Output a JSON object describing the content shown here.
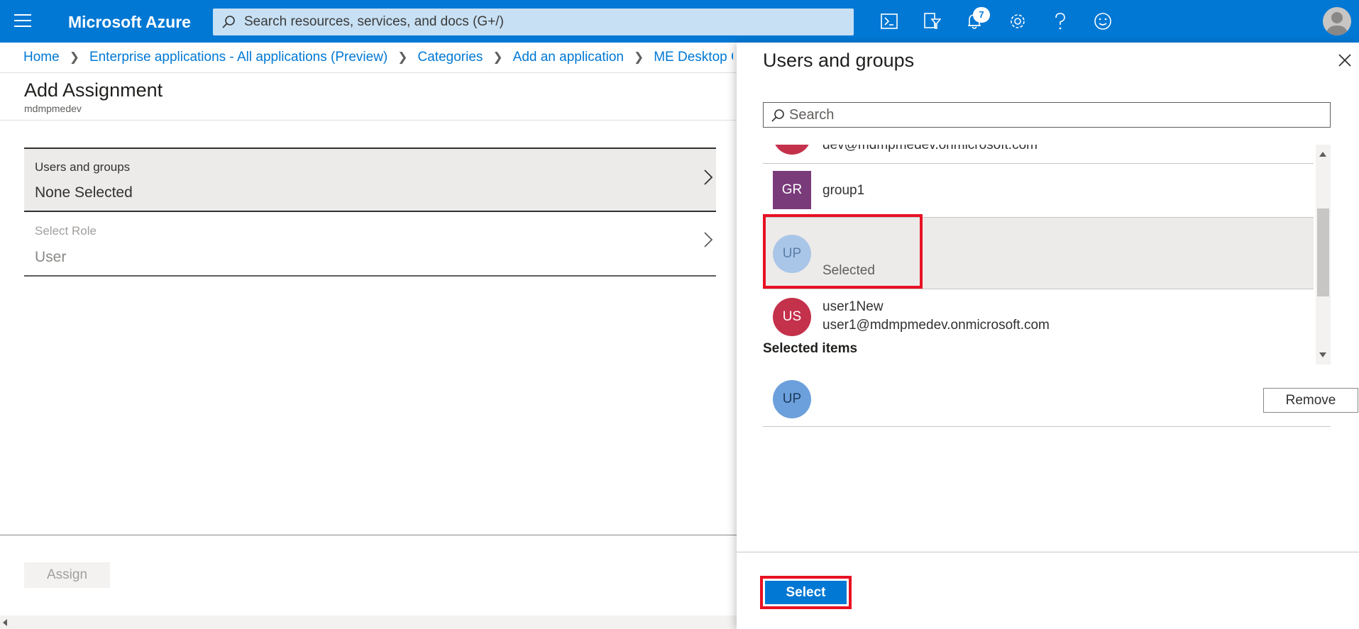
{
  "header": {
    "brand": "Microsoft Azure",
    "search_placeholder": "Search resources, services, and docs (G+/)",
    "notification_count": "7",
    "icons": [
      "cloud-shell-icon",
      "directory-filter-icon",
      "notifications-icon",
      "settings-icon",
      "help-icon",
      "feedback-icon"
    ],
    "accent_color": "#0078d4"
  },
  "breadcrumb": [
    "Home",
    "Enterprise applications - All applications (Preview)",
    "Categories",
    "Add an application",
    "ME Desktop Cen"
  ],
  "page": {
    "title": "Add Assignment",
    "subtitle": "mdmpmedev"
  },
  "assignment": {
    "users_groups_label": "Users and groups",
    "users_groups_value": "None Selected",
    "role_label": "Select Role",
    "role_value": "User"
  },
  "footer": {
    "assign_label": "Assign"
  },
  "panel": {
    "title": "Users and groups",
    "search_placeholder": "Search",
    "items": [
      {
        "initials": "",
        "name": "",
        "sub": "dev@mdmpmedev.onmicrosoft.com",
        "color": "#c4314b"
      },
      {
        "initials": "GR",
        "name": "group1",
        "sub": "",
        "color": "#7a3b7a"
      },
      {
        "initials": "UP",
        "name": "",
        "sub": "Selected",
        "color": "#a9c6e8"
      },
      {
        "initials": "US",
        "name": "user1New",
        "sub": "user1@mdmpmedev.onmicrosoft.com",
        "color": "#c4314b"
      }
    ],
    "selected_title": "Selected items",
    "selected_items": [
      {
        "initials": "UP"
      }
    ],
    "remove_label": "Remove",
    "select_label": "Select"
  }
}
